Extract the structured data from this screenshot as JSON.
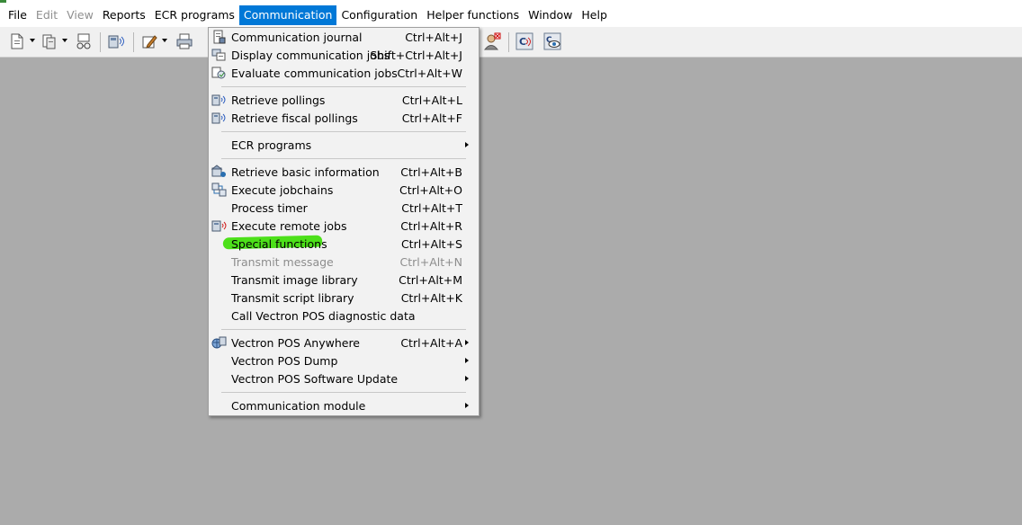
{
  "colors": {
    "accent": "#0078d7",
    "desktop": "#ababab",
    "highlight": "#4de01a"
  },
  "menubar": {
    "items": [
      {
        "label": "File",
        "state": "normal"
      },
      {
        "label": "Edit",
        "state": "disabled"
      },
      {
        "label": "View",
        "state": "disabled"
      },
      {
        "label": "Reports",
        "state": "normal"
      },
      {
        "label": "ECR programs",
        "state": "normal"
      },
      {
        "label": "Communication",
        "state": "active"
      },
      {
        "label": "Configuration",
        "state": "normal"
      },
      {
        "label": "Helper functions",
        "state": "normal"
      },
      {
        "label": "Window",
        "state": "normal"
      },
      {
        "label": "Help",
        "state": "normal"
      }
    ]
  },
  "toolbar": {
    "buttons": [
      {
        "icon": "new-document-icon"
      },
      {
        "icon": "document-stack-icon"
      },
      {
        "icon": "printer-glasses-icon"
      },
      {
        "icon": "terminal-signal-icon"
      },
      {
        "icon": "edit-document-icon"
      },
      {
        "icon": "printer-icon"
      },
      {
        "icon": "user-remove-icon"
      },
      {
        "icon": "communication-c-icon"
      },
      {
        "icon": "view-c-icon"
      }
    ]
  },
  "communication_menu": {
    "items": [
      {
        "label": "Communication journal",
        "shortcut": "Ctrl+Alt+J",
        "icon": "journal-icon"
      },
      {
        "label": "Display communication jobs",
        "shortcut": "Shift+Ctrl+Alt+J",
        "icon": "display-jobs-icon"
      },
      {
        "label": "Evaluate communication jobs",
        "shortcut": "Ctrl+Alt+W",
        "icon": "evaluate-jobs-icon"
      },
      {
        "label": "Retrieve pollings",
        "shortcut": "Ctrl+Alt+L",
        "icon": "terminal-poll-icon"
      },
      {
        "label": "Retrieve fiscal pollings",
        "shortcut": "Ctrl+Alt+F",
        "icon": "terminal-poll-icon"
      },
      {
        "label": "ECR programs",
        "shortcut": "",
        "icon": ""
      },
      {
        "label": "Retrieve basic information",
        "shortcut": "Ctrl+Alt+B",
        "icon": "basic-info-icon"
      },
      {
        "label": "Execute jobchains",
        "shortcut": "Ctrl+Alt+O",
        "icon": "jobchain-icon"
      },
      {
        "label": "Process timer",
        "shortcut": "Ctrl+Alt+T",
        "icon": ""
      },
      {
        "label": "Execute remote jobs",
        "shortcut": "Ctrl+Alt+R",
        "icon": "remote-jobs-icon"
      },
      {
        "label": "Special functions",
        "shortcut": "Ctrl+Alt+S",
        "icon": ""
      },
      {
        "label": "Transmit message",
        "shortcut": "Ctrl+Alt+N",
        "icon": ""
      },
      {
        "label": "Transmit image library",
        "shortcut": "Ctrl+Alt+M",
        "icon": ""
      },
      {
        "label": "Transmit script library",
        "shortcut": "Ctrl+Alt+K",
        "icon": ""
      },
      {
        "label": "Call Vectron POS diagnostic data",
        "shortcut": "",
        "icon": ""
      },
      {
        "label": "Vectron POS Anywhere",
        "shortcut": "Ctrl+Alt+A",
        "icon": "anywhere-icon"
      },
      {
        "label": "Vectron POS Dump",
        "shortcut": "",
        "icon": ""
      },
      {
        "label": "Vectron POS Software Update",
        "shortcut": "",
        "icon": ""
      },
      {
        "label": "Communication module",
        "shortcut": "",
        "icon": ""
      }
    ]
  }
}
